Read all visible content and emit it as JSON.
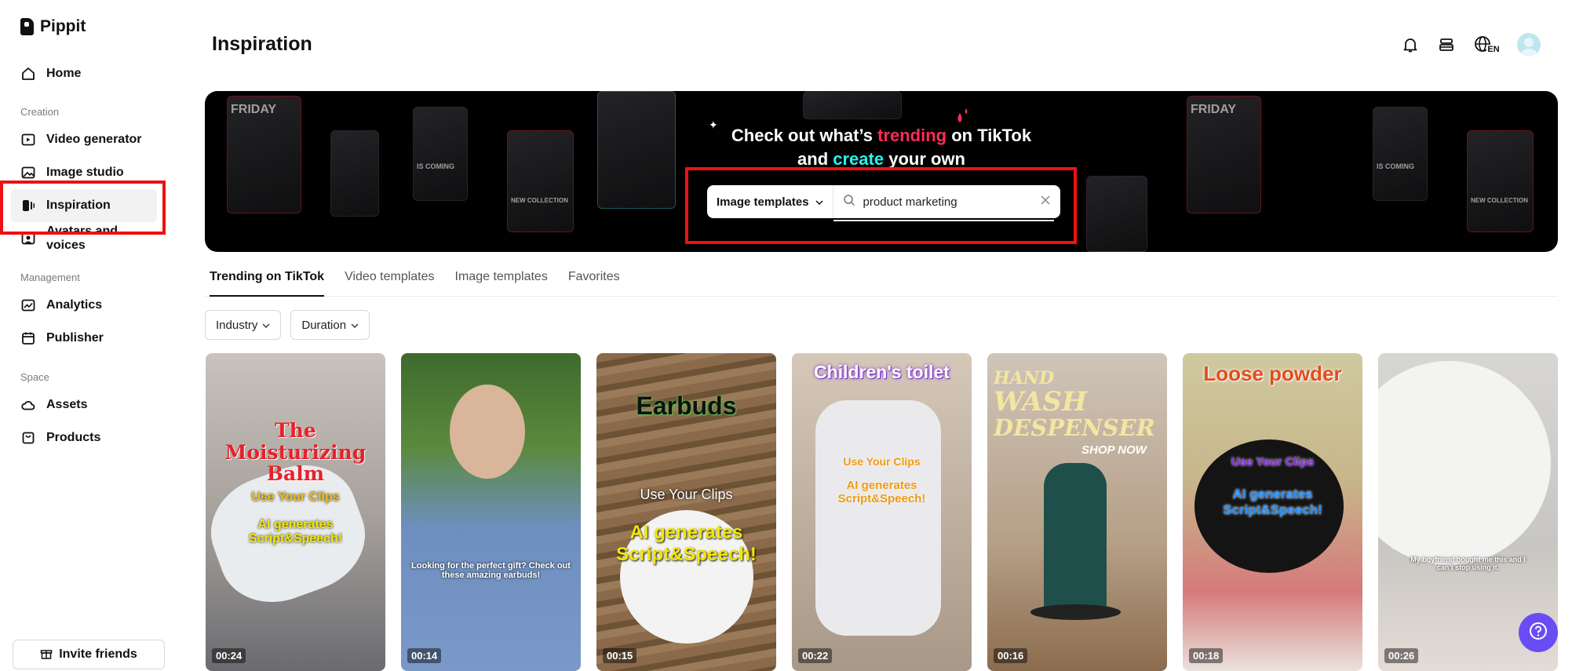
{
  "app": {
    "brand": "Pippit"
  },
  "sidebar": {
    "items": [
      {
        "label": "Home",
        "icon": "home-icon"
      },
      {
        "label": "Video generator",
        "icon": "video-generator-icon"
      },
      {
        "label": "Image studio",
        "icon": "image-studio-icon"
      },
      {
        "label": "Inspiration",
        "icon": "inspiration-icon",
        "active": true
      },
      {
        "label": "Avatars and voices",
        "icon": "avatar-icon"
      },
      {
        "label": "Analytics",
        "icon": "analytics-icon"
      },
      {
        "label": "Publisher",
        "icon": "calendar-icon"
      },
      {
        "label": "Assets",
        "icon": "cloud-icon"
      },
      {
        "label": "Products",
        "icon": "bag-icon"
      }
    ],
    "sections": {
      "creation": "Creation",
      "management": "Management",
      "space": "Space"
    },
    "invite_label": "Invite friends"
  },
  "header": {
    "title": "Inspiration",
    "language": "EN"
  },
  "banner": {
    "line1_prefix": "Check out what’s ",
    "line1_highlight": "trending",
    "line1_suffix": " on TikTok",
    "line2_prefix": "and ",
    "line2_highlight": "create",
    "line2_suffix": " your own",
    "thumb_texts": {
      "friday": "FRIDAY",
      "coming": "IS COMING",
      "collection": "NEW COLLECTION"
    }
  },
  "search": {
    "type_label": "Image templates",
    "value": "product marketing"
  },
  "tabs": [
    {
      "label": "Trending on TikTok",
      "active": true
    },
    {
      "label": "Video templates"
    },
    {
      "label": "Image templates"
    },
    {
      "label": "Favorites"
    }
  ],
  "filters": {
    "industry": "Industry",
    "duration": "Duration"
  },
  "cards": [
    {
      "title": "The Moisturizing Balm",
      "sub1": "Use Your Clips",
      "sub2": "AI generates Script&Speech!",
      "duration": "00:24"
    },
    {
      "caption": "Looking for the perfect gift? Check out these amazing earbuds!",
      "duration": "00:14"
    },
    {
      "title": "Earbuds",
      "sub1": "Use Your Clips",
      "sub2": "AI generates Script&Speech!",
      "duration": "00:15"
    },
    {
      "title": "Children's toilet",
      "sub1": "Use Your Clips",
      "sub2": "AI generates Script&Speech!",
      "duration": "00:22"
    },
    {
      "title_line1": "HAND",
      "title_line2": "WASH",
      "title_line3": "DESPENSER",
      "sub1": "SHOP NOW",
      "duration": "00:16"
    },
    {
      "title": "Loose powder",
      "sub1": "Use Your Clips",
      "sub2": "AI generates Script&Speech!",
      "duration": "00:18"
    },
    {
      "caption": "My boyfriend bought me this and I can't stop using it.",
      "duration": "00:26"
    }
  ],
  "colors": {
    "highlight": "#ee1111",
    "tiktok_pink": "#fe2c55",
    "tiktok_cyan": "#25f4ee",
    "help": "#6a4cf5"
  }
}
